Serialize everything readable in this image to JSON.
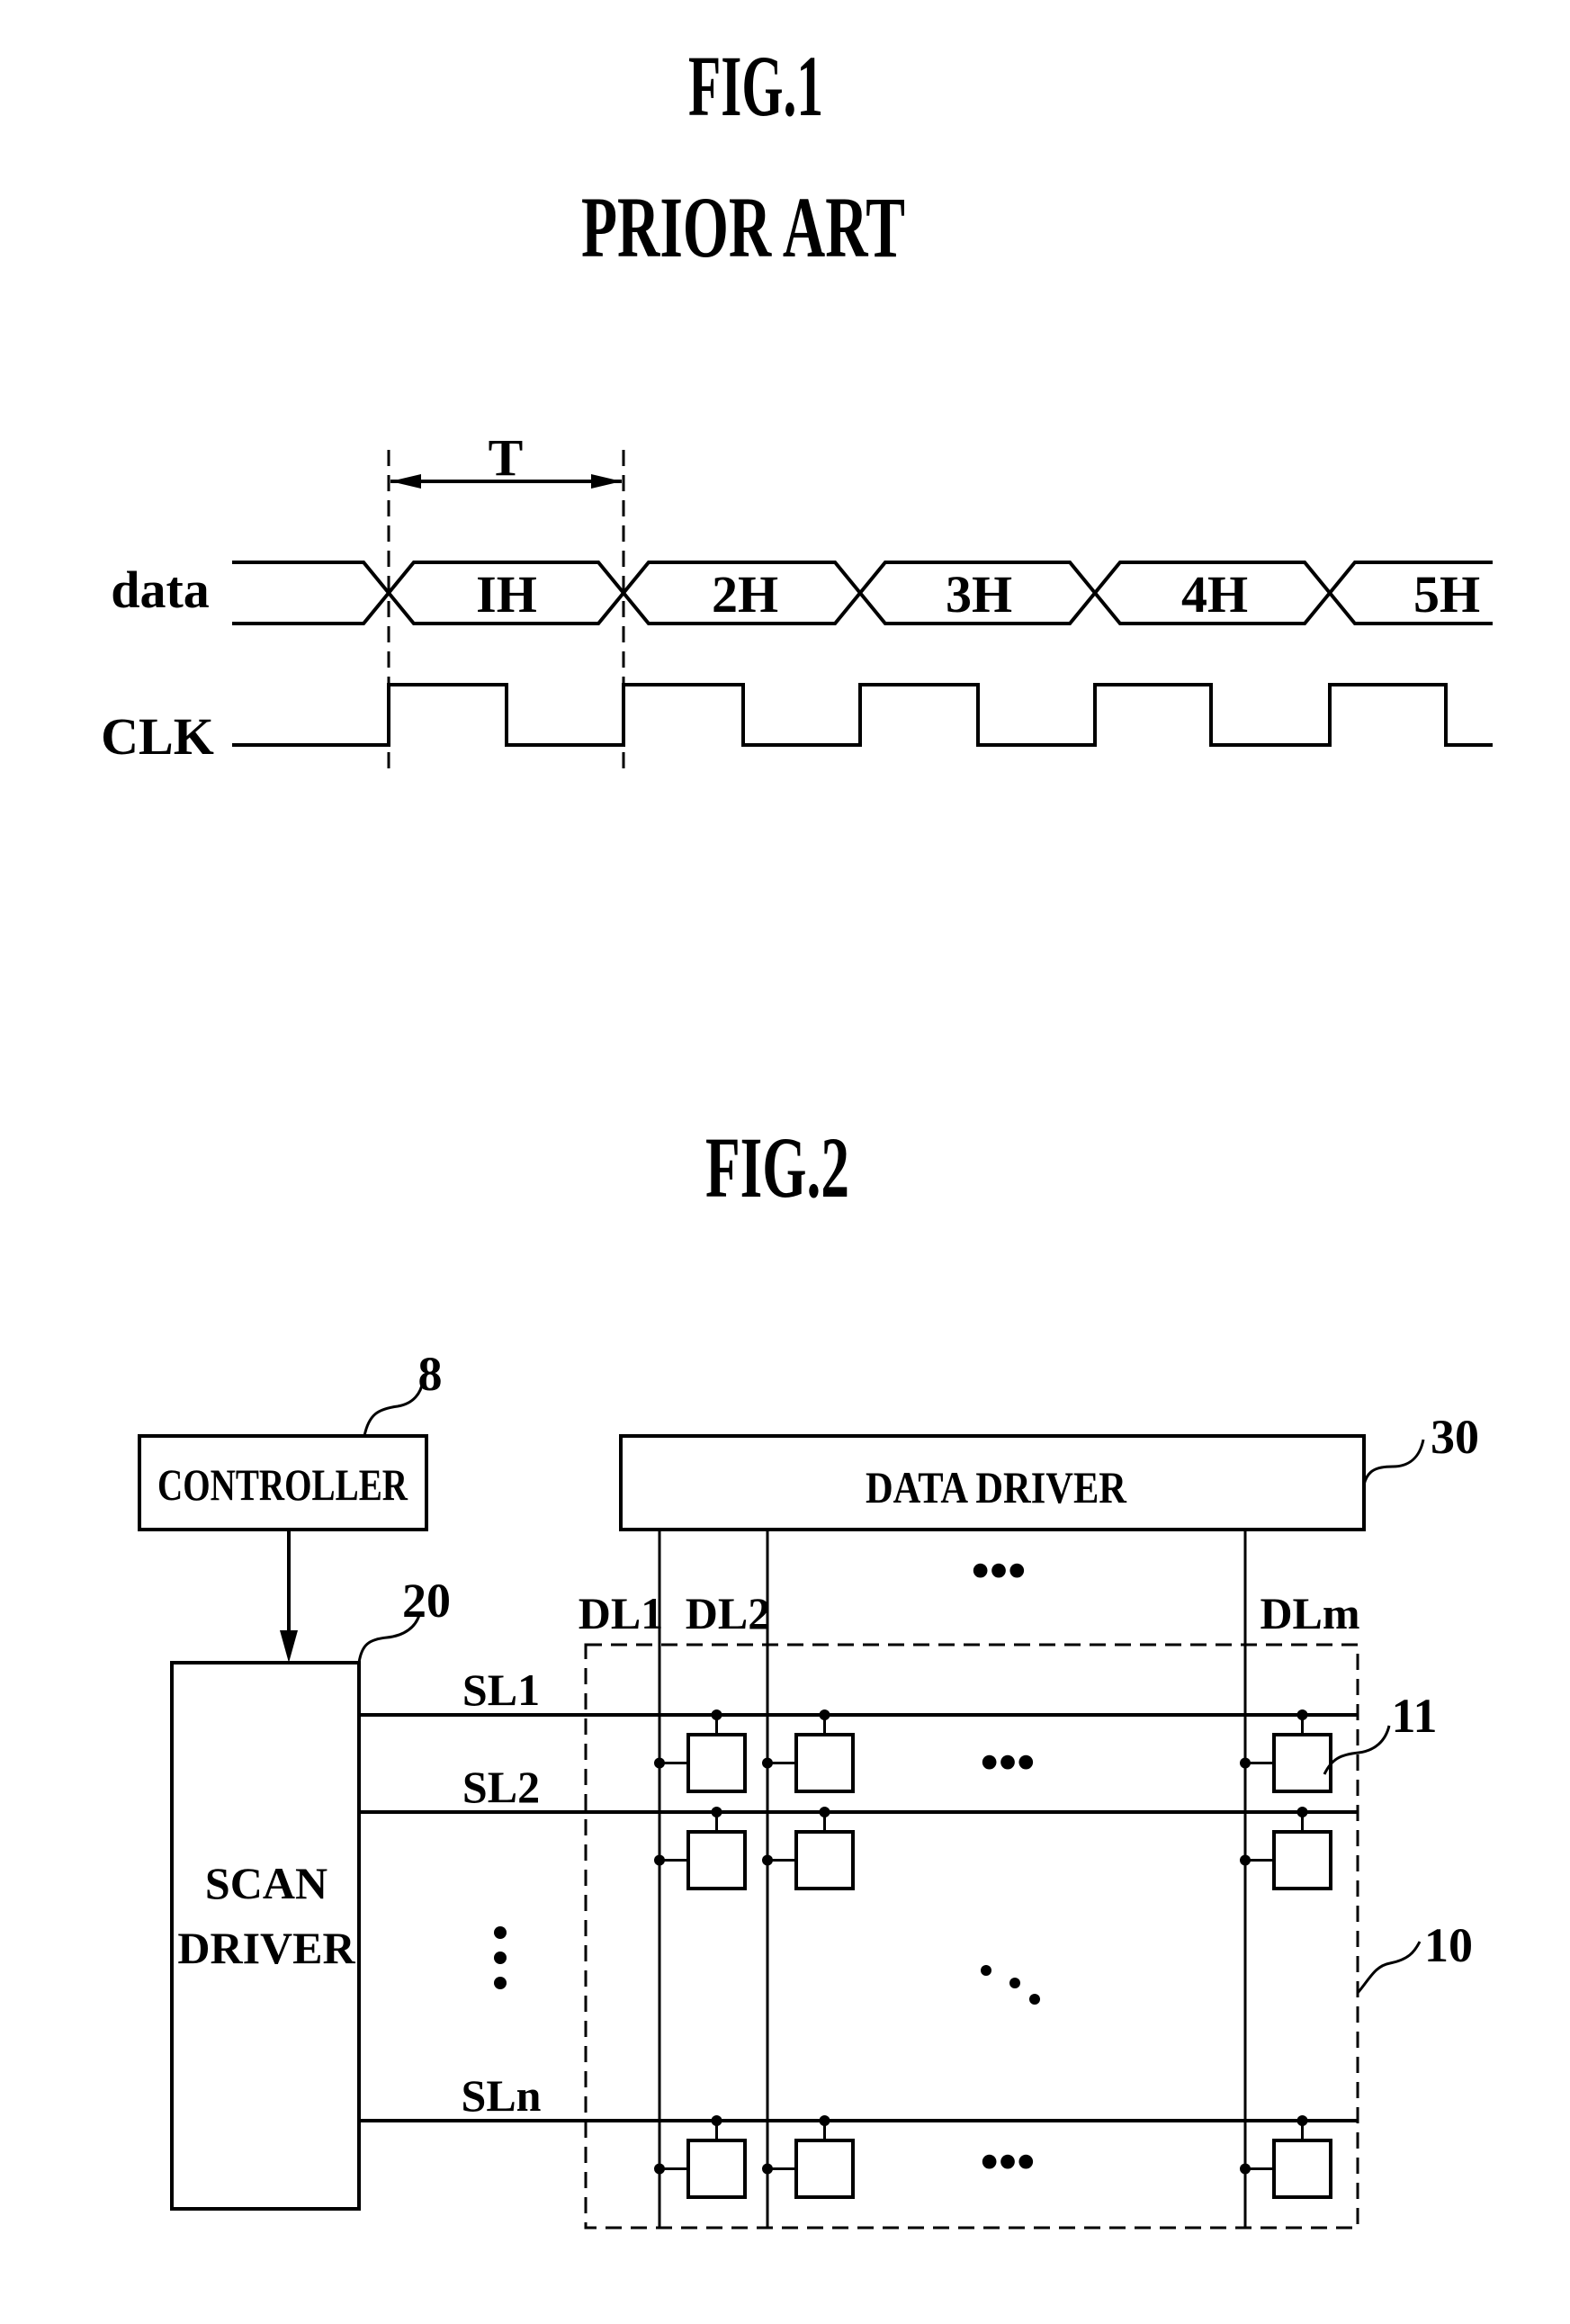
{
  "fig1": {
    "title": "FIG.1",
    "subtitle": "PRIOR ART",
    "period_label": "T",
    "signals": {
      "data_label": "data",
      "clk_label": "CLK"
    },
    "data_segments": [
      "IH",
      "2H",
      "3H",
      "4H",
      "5H"
    ]
  },
  "fig2": {
    "title": "FIG.2",
    "controller": {
      "label": "CONTROLLER",
      "ref": "8"
    },
    "scan_driver": {
      "label_line1": "SCAN",
      "label_line2": "DRIVER",
      "ref": "20"
    },
    "data_driver": {
      "label": "DATA DRIVER",
      "ref": "30"
    },
    "data_lines": [
      "DL1",
      "DL2",
      "DLm"
    ],
    "scan_lines": [
      "SL1",
      "SL2",
      "SLn"
    ],
    "pixel_ref": "11",
    "panel_ref": "10",
    "ellipsis": "•••"
  }
}
